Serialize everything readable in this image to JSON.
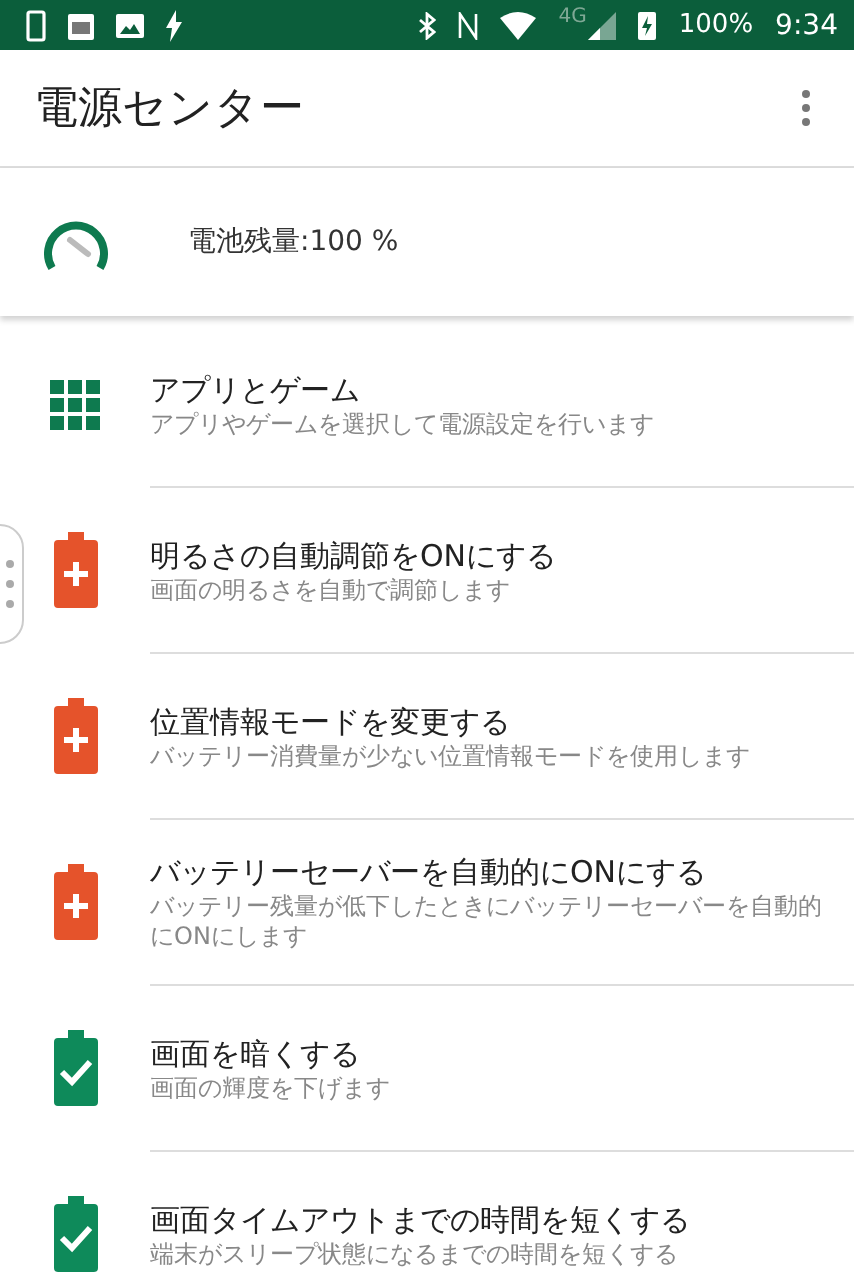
{
  "status_bar": {
    "network": "4G",
    "battery": "100%",
    "time": "9:34"
  },
  "app_bar": {
    "title": "電源センター"
  },
  "battery_card": {
    "text": "電池残量:100 %"
  },
  "items": [
    {
      "kind": "apps",
      "title": "アプリとゲーム",
      "description": "アプリやゲームを選択して電源設定を行います"
    },
    {
      "kind": "alert",
      "title": "明るさの自動調節をONにする",
      "description": "画面の明るさを自動で調節します"
    },
    {
      "kind": "alert",
      "title": "位置情報モードを変更する",
      "description": "バッテリー消費量が少ない位置情報モードを使用します"
    },
    {
      "kind": "alert",
      "title": "バッテリーセーバーを自動的にONにする",
      "description": "バッテリー残量が低下したときにバッテリーセーバーを自動的にONにします"
    },
    {
      "kind": "ok",
      "title": "画面を暗くする",
      "description": "画面の輝度を下げます"
    },
    {
      "kind": "ok",
      "title": "画面タイムアウトまでの時間を短くする",
      "description": "端末がスリープ状態になるまでの時間を短くする"
    }
  ]
}
